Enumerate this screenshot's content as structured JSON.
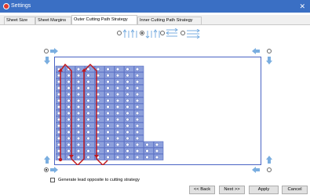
{
  "window": {
    "title": "Settings",
    "close_glyph": "✕"
  },
  "tabs": [
    {
      "label": "Sheet Size"
    },
    {
      "label": "Sheet Margins"
    },
    {
      "label": "Outer Cutting Path Strategy"
    },
    {
      "label": "Inner Cutting Path Strategy"
    }
  ],
  "active_tab": 2,
  "strategy_options": [
    "vertical-meander-up-icon",
    "vertical-meander-selected-icon",
    "horizontal-meander-icon",
    "horizontal-meander-alt-icon"
  ],
  "selected_strategy": 1,
  "start_corner_selected": "bottom-left",
  "grid": {
    "columns": 11,
    "rows": 15,
    "note": "visible part count only"
  },
  "checkbox": {
    "label": "Generate lead opposite to cutting strategy",
    "checked": false
  },
  "buttons": {
    "back": "<< Back",
    "next": "Next >>",
    "apply": "Apply",
    "cancel": "Cancel"
  },
  "colors": {
    "titlebar": "#3a6fc4",
    "part_fill": "#8da0dc",
    "path_red": "#c0181c",
    "arrow_blue": "#7aaee0"
  }
}
